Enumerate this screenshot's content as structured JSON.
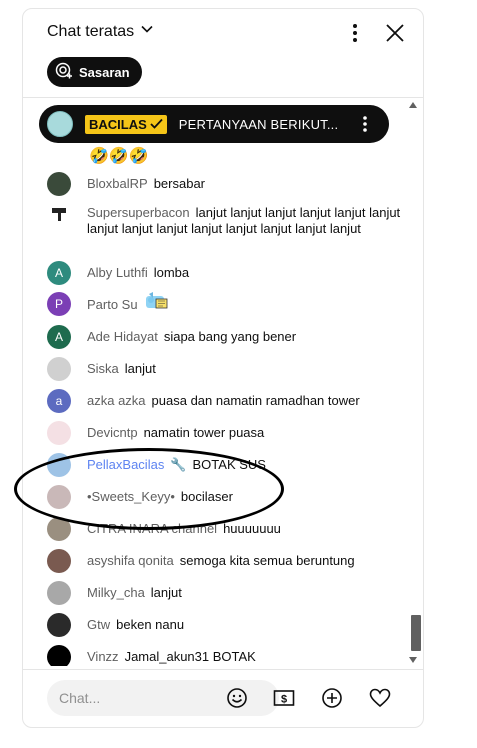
{
  "header": {
    "title": "Chat teratas",
    "chip_label": "Sasaran"
  },
  "pinned": {
    "badge": "BACILAS",
    "text": "PERTANYAAN BERIKUT..."
  },
  "messages": [
    {
      "author": "BloxbalRP",
      "text": "bersabar",
      "avatar_color": "#3a4a3a"
    },
    {
      "author": "Supersuperbacon",
      "text": "lanjut lanjut lanjut lanjut lanjut lanjut lanjut lanjut lanjut lanjut lanjut lanjut lanjut lanjut",
      "avatar_color": "#ffffff"
    },
    {
      "author": "Alby Luthfi",
      "text": "lomba",
      "avatar_letter": "A",
      "avatar_color": "#2e8b7e"
    },
    {
      "author": "Parto Su",
      "text": "",
      "sticker": true,
      "avatar_letter": "P",
      "avatar_color": "#7b3fb5"
    },
    {
      "author": "Ade Hidayat",
      "text": "siapa bang yang bener",
      "avatar_letter": "A",
      "avatar_color": "#1e6b4e"
    },
    {
      "author": "Siska",
      "text": "lanjut",
      "avatar_color": "#d0d0d0"
    },
    {
      "author": "azka azka",
      "text": "puasa dan namatin ramadhan tower",
      "avatar_letter": "a",
      "avatar_color": "#5c6bc0"
    },
    {
      "author": "Devicntp",
      "text": "namatin tower puasa",
      "avatar_color": "#f4e0e4"
    },
    {
      "author": "PellaxBacilas",
      "text": "BOTAK SUS",
      "mod": true,
      "avatar_color": "#9ec3e6"
    },
    {
      "author": "•Sweets_Keyy•",
      "text": "bocilaser",
      "avatar_color": "#c9b8b8"
    },
    {
      "author": "CITRA INARA channel",
      "text": "huuuuuuu",
      "avatar_color": "#9a8f80"
    },
    {
      "author": "asyshifa qonita",
      "text": "semoga kita semua beruntung",
      "avatar_color": "#7a5a50"
    },
    {
      "author": "Milky_cha",
      "text": "lanjut",
      "avatar_color": "#a8a8a8"
    },
    {
      "author": "Gtw",
      "text": "beken nanu",
      "avatar_color": "#2a2a2a"
    },
    {
      "author": "Vinzz",
      "text": "Jamal_akun31 BOTAK",
      "avatar_color": "#000000"
    }
  ],
  "footer": {
    "placeholder": "Chat..."
  }
}
